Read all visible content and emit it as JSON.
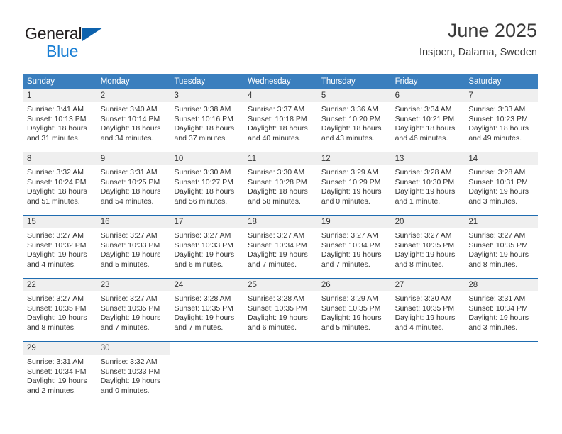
{
  "brand": {
    "name_part1": "General",
    "name_part2": "Blue",
    "flag_icon": "triangle-flag-icon"
  },
  "header": {
    "title": "June 2025",
    "location": "Insjoen, Dalarna, Sweden"
  },
  "colors": {
    "header_blue": "#3b7fbe",
    "row_divider_blue": "#1f6cb0",
    "daynum_band": "#efefef",
    "brand_blue": "#1a7fd4",
    "text": "#333333"
  },
  "calendar": {
    "weekday_headers": [
      "Sunday",
      "Monday",
      "Tuesday",
      "Wednesday",
      "Thursday",
      "Friday",
      "Saturday"
    ],
    "weeks": [
      [
        {
          "day": "1",
          "sunrise": "Sunrise: 3:41 AM",
          "sunset": "Sunset: 10:13 PM",
          "daylight1": "Daylight: 18 hours",
          "daylight2": "and 31 minutes."
        },
        {
          "day": "2",
          "sunrise": "Sunrise: 3:40 AM",
          "sunset": "Sunset: 10:14 PM",
          "daylight1": "Daylight: 18 hours",
          "daylight2": "and 34 minutes."
        },
        {
          "day": "3",
          "sunrise": "Sunrise: 3:38 AM",
          "sunset": "Sunset: 10:16 PM",
          "daylight1": "Daylight: 18 hours",
          "daylight2": "and 37 minutes."
        },
        {
          "day": "4",
          "sunrise": "Sunrise: 3:37 AM",
          "sunset": "Sunset: 10:18 PM",
          "daylight1": "Daylight: 18 hours",
          "daylight2": "and 40 minutes."
        },
        {
          "day": "5",
          "sunrise": "Sunrise: 3:36 AM",
          "sunset": "Sunset: 10:20 PM",
          "daylight1": "Daylight: 18 hours",
          "daylight2": "and 43 minutes."
        },
        {
          "day": "6",
          "sunrise": "Sunrise: 3:34 AM",
          "sunset": "Sunset: 10:21 PM",
          "daylight1": "Daylight: 18 hours",
          "daylight2": "and 46 minutes."
        },
        {
          "day": "7",
          "sunrise": "Sunrise: 3:33 AM",
          "sunset": "Sunset: 10:23 PM",
          "daylight1": "Daylight: 18 hours",
          "daylight2": "and 49 minutes."
        }
      ],
      [
        {
          "day": "8",
          "sunrise": "Sunrise: 3:32 AM",
          "sunset": "Sunset: 10:24 PM",
          "daylight1": "Daylight: 18 hours",
          "daylight2": "and 51 minutes."
        },
        {
          "day": "9",
          "sunrise": "Sunrise: 3:31 AM",
          "sunset": "Sunset: 10:25 PM",
          "daylight1": "Daylight: 18 hours",
          "daylight2": "and 54 minutes."
        },
        {
          "day": "10",
          "sunrise": "Sunrise: 3:30 AM",
          "sunset": "Sunset: 10:27 PM",
          "daylight1": "Daylight: 18 hours",
          "daylight2": "and 56 minutes."
        },
        {
          "day": "11",
          "sunrise": "Sunrise: 3:30 AM",
          "sunset": "Sunset: 10:28 PM",
          "daylight1": "Daylight: 18 hours",
          "daylight2": "and 58 minutes."
        },
        {
          "day": "12",
          "sunrise": "Sunrise: 3:29 AM",
          "sunset": "Sunset: 10:29 PM",
          "daylight1": "Daylight: 19 hours",
          "daylight2": "and 0 minutes."
        },
        {
          "day": "13",
          "sunrise": "Sunrise: 3:28 AM",
          "sunset": "Sunset: 10:30 PM",
          "daylight1": "Daylight: 19 hours",
          "daylight2": "and 1 minute."
        },
        {
          "day": "14",
          "sunrise": "Sunrise: 3:28 AM",
          "sunset": "Sunset: 10:31 PM",
          "daylight1": "Daylight: 19 hours",
          "daylight2": "and 3 minutes."
        }
      ],
      [
        {
          "day": "15",
          "sunrise": "Sunrise: 3:27 AM",
          "sunset": "Sunset: 10:32 PM",
          "daylight1": "Daylight: 19 hours",
          "daylight2": "and 4 minutes."
        },
        {
          "day": "16",
          "sunrise": "Sunrise: 3:27 AM",
          "sunset": "Sunset: 10:33 PM",
          "daylight1": "Daylight: 19 hours",
          "daylight2": "and 5 minutes."
        },
        {
          "day": "17",
          "sunrise": "Sunrise: 3:27 AM",
          "sunset": "Sunset: 10:33 PM",
          "daylight1": "Daylight: 19 hours",
          "daylight2": "and 6 minutes."
        },
        {
          "day": "18",
          "sunrise": "Sunrise: 3:27 AM",
          "sunset": "Sunset: 10:34 PM",
          "daylight1": "Daylight: 19 hours",
          "daylight2": "and 7 minutes."
        },
        {
          "day": "19",
          "sunrise": "Sunrise: 3:27 AM",
          "sunset": "Sunset: 10:34 PM",
          "daylight1": "Daylight: 19 hours",
          "daylight2": "and 7 minutes."
        },
        {
          "day": "20",
          "sunrise": "Sunrise: 3:27 AM",
          "sunset": "Sunset: 10:35 PM",
          "daylight1": "Daylight: 19 hours",
          "daylight2": "and 8 minutes."
        },
        {
          "day": "21",
          "sunrise": "Sunrise: 3:27 AM",
          "sunset": "Sunset: 10:35 PM",
          "daylight1": "Daylight: 19 hours",
          "daylight2": "and 8 minutes."
        }
      ],
      [
        {
          "day": "22",
          "sunrise": "Sunrise: 3:27 AM",
          "sunset": "Sunset: 10:35 PM",
          "daylight1": "Daylight: 19 hours",
          "daylight2": "and 8 minutes."
        },
        {
          "day": "23",
          "sunrise": "Sunrise: 3:27 AM",
          "sunset": "Sunset: 10:35 PM",
          "daylight1": "Daylight: 19 hours",
          "daylight2": "and 7 minutes."
        },
        {
          "day": "24",
          "sunrise": "Sunrise: 3:28 AM",
          "sunset": "Sunset: 10:35 PM",
          "daylight1": "Daylight: 19 hours",
          "daylight2": "and 7 minutes."
        },
        {
          "day": "25",
          "sunrise": "Sunrise: 3:28 AM",
          "sunset": "Sunset: 10:35 PM",
          "daylight1": "Daylight: 19 hours",
          "daylight2": "and 6 minutes."
        },
        {
          "day": "26",
          "sunrise": "Sunrise: 3:29 AM",
          "sunset": "Sunset: 10:35 PM",
          "daylight1": "Daylight: 19 hours",
          "daylight2": "and 5 minutes."
        },
        {
          "day": "27",
          "sunrise": "Sunrise: 3:30 AM",
          "sunset": "Sunset: 10:35 PM",
          "daylight1": "Daylight: 19 hours",
          "daylight2": "and 4 minutes."
        },
        {
          "day": "28",
          "sunrise": "Sunrise: 3:31 AM",
          "sunset": "Sunset: 10:34 PM",
          "daylight1": "Daylight: 19 hours",
          "daylight2": "and 3 minutes."
        }
      ],
      [
        {
          "day": "29",
          "sunrise": "Sunrise: 3:31 AM",
          "sunset": "Sunset: 10:34 PM",
          "daylight1": "Daylight: 19 hours",
          "daylight2": "and 2 minutes."
        },
        {
          "day": "30",
          "sunrise": "Sunrise: 3:32 AM",
          "sunset": "Sunset: 10:33 PM",
          "daylight1": "Daylight: 19 hours",
          "daylight2": "and 0 minutes."
        },
        {
          "day": "",
          "sunrise": "",
          "sunset": "",
          "daylight1": "",
          "daylight2": ""
        },
        {
          "day": "",
          "sunrise": "",
          "sunset": "",
          "daylight1": "",
          "daylight2": ""
        },
        {
          "day": "",
          "sunrise": "",
          "sunset": "",
          "daylight1": "",
          "daylight2": ""
        },
        {
          "day": "",
          "sunrise": "",
          "sunset": "",
          "daylight1": "",
          "daylight2": ""
        },
        {
          "day": "",
          "sunrise": "",
          "sunset": "",
          "daylight1": "",
          "daylight2": ""
        }
      ]
    ]
  }
}
